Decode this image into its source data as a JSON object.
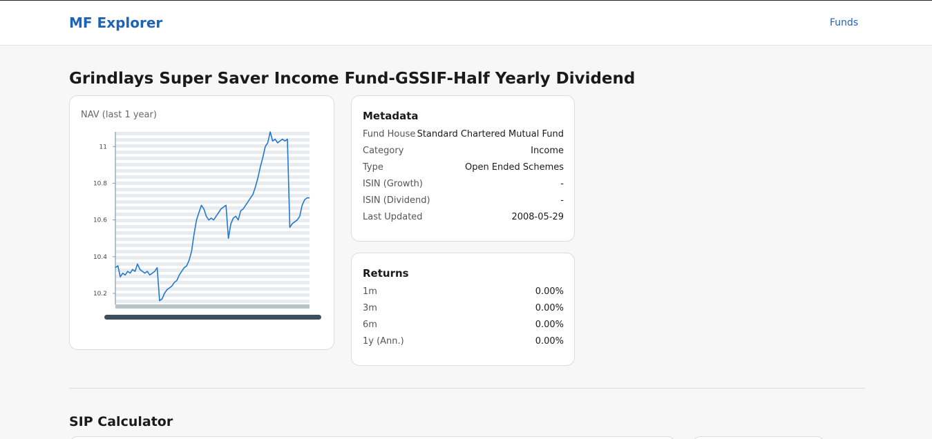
{
  "app": {
    "brand": "MF Explorer",
    "nav": {
      "funds_label": "Funds"
    }
  },
  "fund": {
    "title": "Grindlays Super Saver Income Fund-GSSIF-Half Yearly Dividend"
  },
  "nav_chart": {
    "label": "NAV (last 1 year)"
  },
  "metadata": {
    "title": "Metadata",
    "rows": [
      {
        "key": "Fund House",
        "value": "Standard Chartered Mutual Fund"
      },
      {
        "key": "Category",
        "value": "Income"
      },
      {
        "key": "Type",
        "value": "Open Ended Schemes"
      },
      {
        "key": "ISIN (Growth)",
        "value": "-"
      },
      {
        "key": "ISIN (Dividend)",
        "value": "-"
      },
      {
        "key": "Last Updated",
        "value": "2008-05-29"
      }
    ]
  },
  "returns": {
    "title": "Returns",
    "rows": [
      {
        "key": "1m",
        "value": "0.00%"
      },
      {
        "key": "3m",
        "value": "0.00%"
      },
      {
        "key": "6m",
        "value": "0.00%"
      },
      {
        "key": "1y (Ann.)",
        "value": "0.00%"
      }
    ]
  },
  "sip": {
    "title": "SIP Calculator"
  },
  "colors": {
    "brand": "#1f63b8",
    "line": "#1f77d0",
    "axis": "#7a9cab"
  },
  "chart_data": {
    "type": "line",
    "title": "NAV (last 1 year)",
    "xlabel": "",
    "ylabel": "",
    "ylim": [
      10.14,
      11.08
    ],
    "y_ticks": [
      10.2,
      10.4,
      10.6,
      10.8,
      11
    ],
    "grid": true,
    "series": [
      {
        "values": [
          10.34,
          10.35,
          10.29,
          10.31,
          10.3,
          10.32,
          10.31,
          10.33,
          10.32,
          10.36,
          10.33,
          10.32,
          10.31,
          10.32,
          10.3,
          10.31,
          10.32,
          10.34,
          10.16,
          10.17,
          10.2,
          10.22,
          10.23,
          10.24,
          10.26,
          10.27,
          10.3,
          10.32,
          10.34,
          10.35,
          10.38,
          10.43,
          10.52,
          10.6,
          10.64,
          10.68,
          10.66,
          10.62,
          10.6,
          10.61,
          10.6,
          10.62,
          10.64,
          10.66,
          10.67,
          10.68,
          10.5,
          10.58,
          10.61,
          10.62,
          10.6,
          10.65,
          10.66,
          10.68,
          10.7,
          10.72,
          10.74,
          10.78,
          10.83,
          10.89,
          10.94,
          11.0,
          11.02,
          11.08,
          11.03,
          11.04,
          11.02,
          11.03,
          11.04,
          11.03,
          11.04,
          10.56,
          10.58,
          10.59,
          10.6,
          10.62,
          10.68,
          10.71,
          10.72,
          10.72
        ]
      }
    ]
  }
}
